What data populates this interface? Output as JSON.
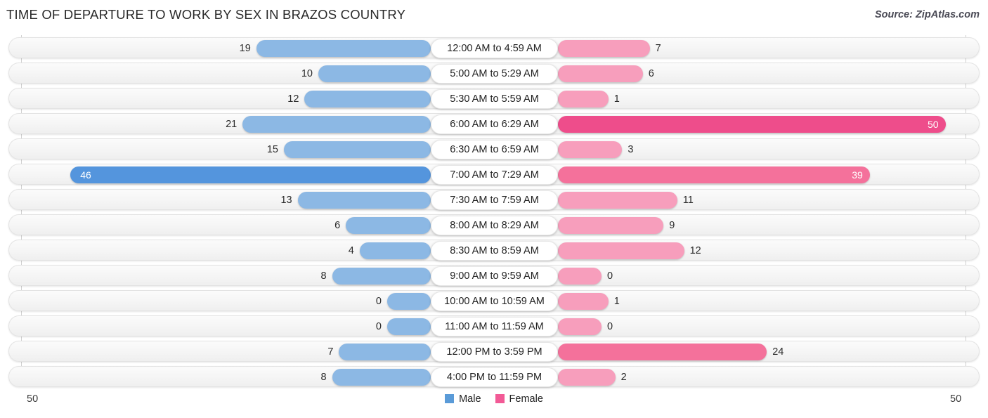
{
  "header": {
    "title": "TIME OF DEPARTURE TO WORK BY SEX IN BRAZOS COUNTRY",
    "source": "Source: ZipAtlas.com"
  },
  "footer": {
    "tick_left": "50",
    "tick_right": "50",
    "legend": [
      {
        "label": "Male",
        "color": "#5a9bd8"
      },
      {
        "label": "Female",
        "color": "#f25a96"
      }
    ]
  },
  "colors": {
    "male_normal": "#8cb8e4",
    "male_max": "#5495dd",
    "female_light": "#f79ebc",
    "female_mid": "#f4719b",
    "female_max": "#ee4d8b",
    "track": "#f5f5f5",
    "pill": "#ffffff"
  },
  "chart_data": {
    "type": "bar",
    "subtype": "diverging-bidirectional",
    "title": "TIME OF DEPARTURE TO WORK BY SEX IN BRAZOS COUNTRY",
    "xlabel": "",
    "ylabel": "",
    "xlim": [
      50,
      50
    ],
    "axis_ticks": [
      "50",
      "50"
    ],
    "grid": false,
    "legend_position": "bottom-center",
    "categories": [
      "12:00 AM to 4:59 AM",
      "5:00 AM to 5:29 AM",
      "5:30 AM to 5:59 AM",
      "6:00 AM to 6:29 AM",
      "6:30 AM to 6:59 AM",
      "7:00 AM to 7:29 AM",
      "7:30 AM to 7:59 AM",
      "8:00 AM to 8:29 AM",
      "8:30 AM to 8:59 AM",
      "9:00 AM to 9:59 AM",
      "10:00 AM to 10:59 AM",
      "11:00 AM to 11:59 AM",
      "12:00 PM to 3:59 PM",
      "4:00 PM to 11:59 PM"
    ],
    "series": [
      {
        "name": "Male",
        "side": "left",
        "values": [
          19,
          10,
          12,
          21,
          15,
          46,
          13,
          6,
          4,
          8,
          0,
          0,
          7,
          8
        ]
      },
      {
        "name": "Female",
        "side": "right",
        "values": [
          7,
          6,
          1,
          50,
          3,
          39,
          11,
          9,
          12,
          0,
          1,
          0,
          24,
          2
        ]
      }
    ]
  }
}
